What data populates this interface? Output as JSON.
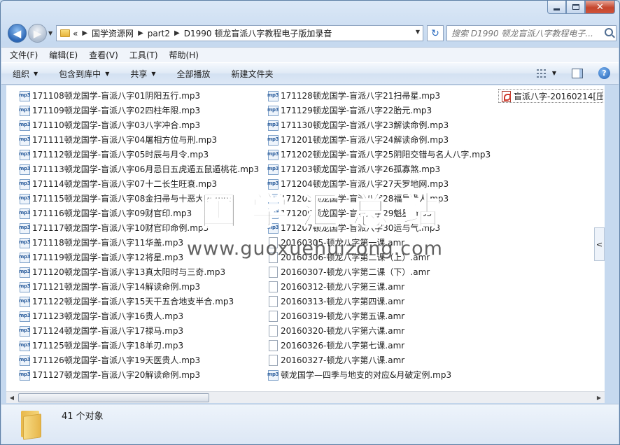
{
  "window": {
    "caption_buttons": {
      "minimize": "minimize-icon",
      "maximize": "maximize-icon",
      "close": "✕"
    }
  },
  "nav": {
    "back_icon": "◀",
    "forward_icon": "▶",
    "breadcrumb_prefix": "«",
    "crumbs": [
      "国学资源网",
      "part2",
      "D1990 顿龙盲派八字教程电子版加录音"
    ],
    "refresh_icon": "↻",
    "search_placeholder": "搜索 D1990 顿龙盲派八字教程电子..."
  },
  "menubar": [
    "文件(F)",
    "编辑(E)",
    "查看(V)",
    "工具(T)",
    "帮助(H)"
  ],
  "cmdbar": {
    "organize": "组织",
    "include_library": "包含到库中",
    "share": "共享",
    "play_all": "全部播放",
    "new_folder": "新建文件夹",
    "help_icon": "?"
  },
  "files": {
    "col1": [
      "171108顿龙国学-盲派八字01阴阳五行.mp3",
      "171109顿龙国学-盲派八字02四柱年限.mp3",
      "171110顿龙国学-盲派八字03八字冲合.mp3",
      "171111顿龙国学-盲派八字04屠相方位与刑.mp3",
      "171112顿龙国学-盲派八字05时辰与月令.mp3",
      "171113顿龙国学-盲派八字06月忌日五虎遁五鼠遁桃花.mp3",
      "171114顿龙国学-盲派八字07十二长生旺衰.mp3",
      "171115顿龙国学-盲派八字08金扫帚与十恶大败.mp3",
      "171116顿龙国学-盲派八字09财官印.mp3",
      "171117顿龙国学-盲派八字10财官印命例.mp3",
      "171118顿龙国学-盲派八字11华盖.mp3",
      "171119顿龙国学-盲派八字12将星.mp3",
      "171120顿龙国学-盲派八字13真太阳时与三奇.mp3",
      "171121顿龙国学-盲派八字14解读命例.mp3",
      "171122顿龙国学-盲派八字15天干五合地支半合.mp3",
      "171123顿龙国学-盲派八字16贵人.mp3",
      "171124顿龙国学-盲派八字17禄马.mp3",
      "171125顿龙国学-盲派八字18羊刃.mp3",
      "171126顿龙国学-盲派八字19天医贵人.mp3",
      "171127顿龙国学-盲派八字20解读命例.mp3"
    ],
    "col2": [
      {
        "name": "171128顿龙国学-盲派八字21扫帚星.mp3",
        "type": "mp3"
      },
      {
        "name": "171129顿龙国学-盲派八字22胎元.mp3",
        "type": "mp3"
      },
      {
        "name": "171130顿龙国学-盲派八字23解读命例.mp3",
        "type": "mp3"
      },
      {
        "name": "171201顿龙国学-盲派八字24解读命例.mp3",
        "type": "mp3"
      },
      {
        "name": "171202顿龙国学-盲派八字25阴阳交错与名人八字.mp3",
        "type": "mp3"
      },
      {
        "name": "171203顿龙国学-盲派八字26孤寡煞.mp3",
        "type": "mp3"
      },
      {
        "name": "171204顿龙国学-盲派八字27天罗地网.mp3",
        "type": "mp3"
      },
      {
        "name": "171205顿龙国学-盲派八字28福星贵人.mp3",
        "type": "mp3"
      },
      {
        "name": "171206顿龙国学-盲派八字29魁星.mp3",
        "type": "mp3"
      },
      {
        "name": "171207顿龙国学-盲派八字30运与气.mp3",
        "type": "mp3"
      },
      {
        "name": "20160305-顿龙八字第一课.amr",
        "type": "amr"
      },
      {
        "name": "20160306-顿龙八字第二课（上）.amr",
        "type": "amr"
      },
      {
        "name": "20160307-顿龙八字第二课（下）.amr",
        "type": "amr"
      },
      {
        "name": "20160312-顿龙八字第三课.amr",
        "type": "amr"
      },
      {
        "name": "20160313-顿龙八字第四课.amr",
        "type": "amr"
      },
      {
        "name": "20160319-顿龙八字第五课.amr",
        "type": "amr"
      },
      {
        "name": "20160320-顿龙八字第六课.amr",
        "type": "amr"
      },
      {
        "name": "20160326-顿龙八字第七课.amr",
        "type": "amr"
      },
      {
        "name": "20160327-顿龙八字第八课.amr",
        "type": "amr"
      },
      {
        "name": "顿龙国学—四季与地支的对应&月破定例.mp3",
        "type": "mp3"
      }
    ],
    "col3": [
      {
        "name": "盲派八字-20160214[压缩",
        "type": "pdf"
      }
    ]
  },
  "watermark": {
    "chinese": "国学汇总站",
    "url": "www.guoxuehuizong.com"
  },
  "status": {
    "count_text": "41 个对象"
  },
  "icons": {
    "file_mp3": "mp3-file-icon",
    "file_amr": "audio-file-icon",
    "file_pdf": "pdf-file-icon",
    "folder": "folder-icon"
  }
}
